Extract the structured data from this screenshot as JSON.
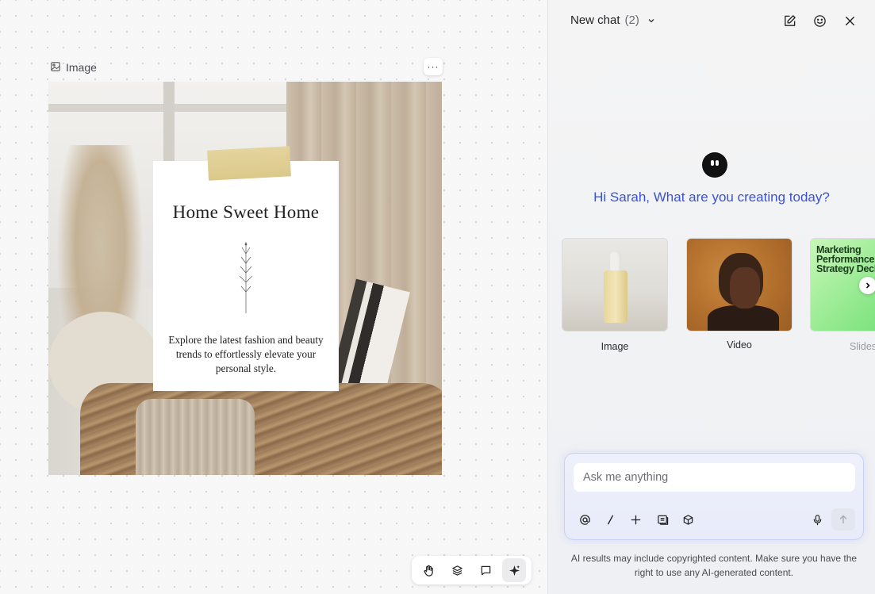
{
  "canvas": {
    "frame_label": "Image",
    "more_label": "···",
    "card": {
      "title": "Home Sweet Home",
      "body": "Explore the latest fashion and beauty trends to effortlessly elevate your personal style."
    },
    "toolbar": {
      "tools": [
        "hand-tool",
        "layers-tool",
        "comment-tool",
        "ai-sparkle-tool"
      ],
      "active": "ai-sparkle-tool"
    }
  },
  "chat": {
    "title": "New chat",
    "count": "(2)",
    "greeting": "Hi Sarah, What are you creating today?",
    "suggestions": [
      {
        "label": "Image"
      },
      {
        "label": "Video"
      },
      {
        "label": "Slides",
        "thumb_text": "Marketing Performance & Strategy Deck"
      }
    ],
    "input_placeholder": "Ask me anything",
    "disclaimer": "AI results may include copyrighted content. Make sure you have the right to use any AI-generated content."
  },
  "colors": {
    "accent": "#3b52d4",
    "composer_border": "#c9d0f5"
  }
}
